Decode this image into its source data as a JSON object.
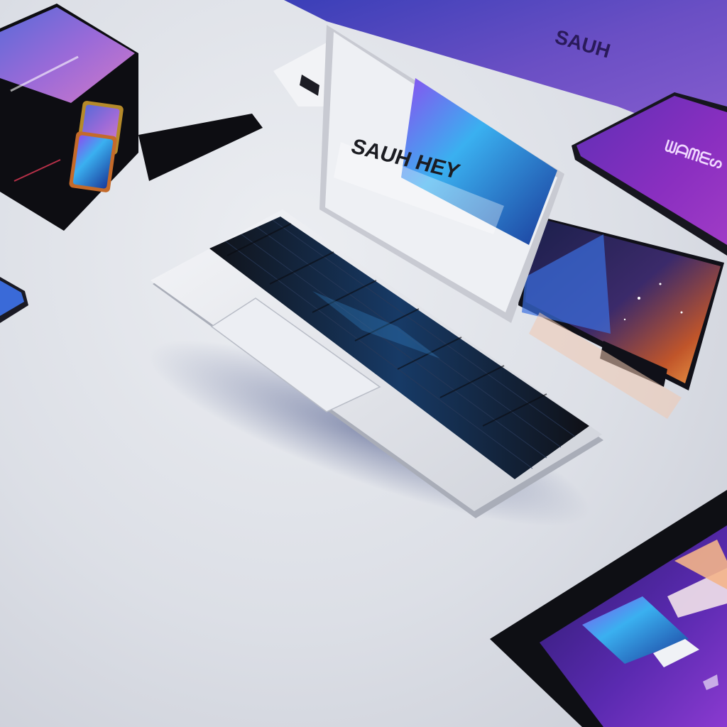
{
  "scene": {
    "description_visible_text": {
      "laptop_screen_text": "SAUH HEY",
      "top_right_panel_logo": "SAUH",
      "purple_card_logo": "ᗯᗩᗰᗴᔕ"
    }
  },
  "colors": {
    "background": "#dfe1e7",
    "purple": "#6b2fb0",
    "violet": "#5b4fb6",
    "blue": "#2f8ee8",
    "cyan": "#49d0f0",
    "dark": "#111218",
    "silver": "#e6e7eb"
  },
  "icons": [
    "laptop",
    "monitor",
    "tablet",
    "phone",
    "cube-device",
    "keyboard",
    "trackpad",
    "galaxy-screen"
  ]
}
